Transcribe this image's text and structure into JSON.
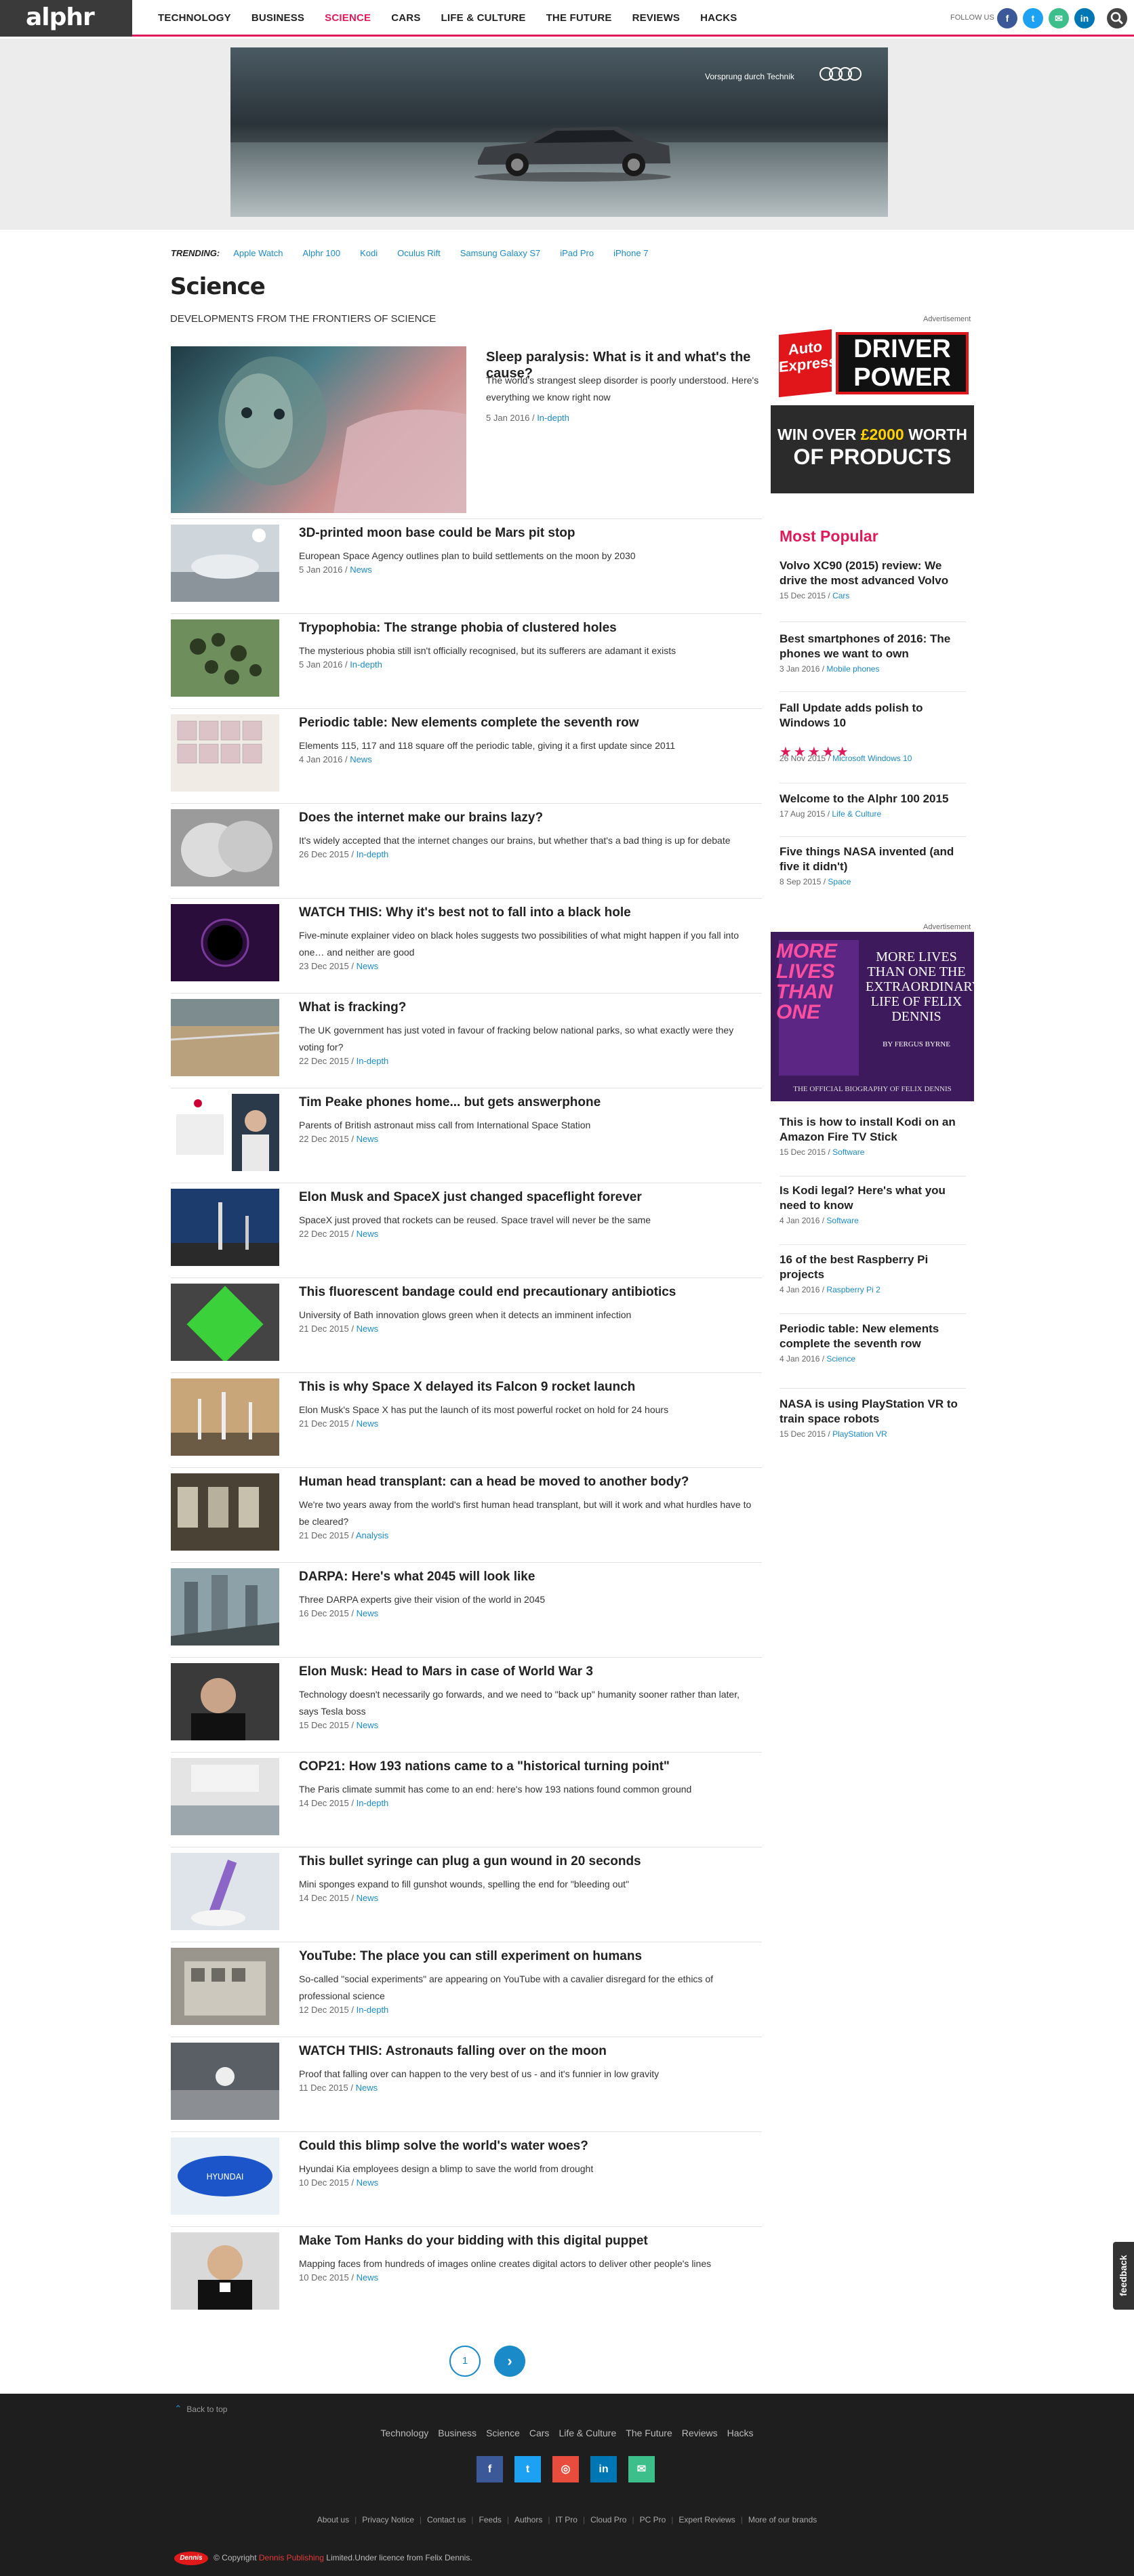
{
  "header": {
    "logo": "alphr",
    "nav": [
      "TECHNOLOGY",
      "BUSINESS",
      "SCIENCE",
      "CARS",
      "LIFE & CULTURE",
      "THE FUTURE",
      "REVIEWS",
      "HACKS"
    ],
    "active_nav": "SCIENCE",
    "follow_label": "FOLLOW US",
    "social": [
      {
        "icon": "facebook-icon",
        "glyph": "f",
        "color": "#3b5998"
      },
      {
        "icon": "twitter-icon",
        "glyph": "t",
        "color": "#1da1f2"
      },
      {
        "icon": "email-icon",
        "glyph": "✉",
        "color": "#3dbf8b"
      },
      {
        "icon": "linkedin-icon",
        "glyph": "in",
        "color": "#0077b5"
      }
    ]
  },
  "top_ad": {
    "brand_text": "Vorsprung durch Technik",
    "brand": "Audi"
  },
  "trending": {
    "label": "TRENDING:",
    "items": [
      "Apple Watch",
      "Alphr 100",
      "Kodi",
      "Oculus Rift",
      "Samsung Galaxy S7",
      "iPad Pro",
      "iPhone 7"
    ]
  },
  "page": {
    "title": "Science",
    "subtitle": "DEVELOPMENTS FROM THE FRONTIERS OF SCIENCE"
  },
  "featured": {
    "title": "Sleep paralysis: What is it and what's the cause?",
    "desc": "The world's strangest sleep disorder is poorly understood. Here's everything we know right now",
    "date": "5 Jan 2016",
    "tag": "In-depth"
  },
  "articles": [
    {
      "title": "3D-printed moon base could be Mars pit stop",
      "desc": "European Space Agency outlines plan to build settlements on the moon by 2030",
      "date": "5 Jan 2016",
      "tag": "News"
    },
    {
      "title": "Trypophobia: The strange phobia of clustered holes",
      "desc": "The mysterious phobia still isn't officially recognised, but its sufferers are adamant it exists",
      "date": "5 Jan 2016",
      "tag": "In-depth"
    },
    {
      "title": "Periodic table: New elements complete the seventh row",
      "desc": "Elements 115, 117 and 118 square off the periodic table, giving it a first update since 2011",
      "date": "4 Jan 2016",
      "tag": "News"
    },
    {
      "title": "Does the internet make our brains lazy?",
      "desc": "It's widely accepted that the internet changes our brains, but whether that's a bad thing is up for debate",
      "date": "26 Dec 2015",
      "tag": "In-depth"
    },
    {
      "title": "WATCH THIS: Why it's best not to fall into a black hole",
      "desc": "Five-minute explainer video on black holes suggests two possibilities of what might happen if you fall into one… and neither are good",
      "date": "23 Dec 2015",
      "tag": "News"
    },
    {
      "title": "What is fracking?",
      "desc": "The UK government has just voted in favour of fracking below national parks, so what exactly were they voting for?",
      "date": "22 Dec 2015",
      "tag": "In-depth"
    },
    {
      "title": "Tim Peake phones home... but gets answerphone",
      "desc": "Parents of British astronaut miss call from International Space Station",
      "date": "22 Dec 2015",
      "tag": "News"
    },
    {
      "title": "Elon Musk and SpaceX just changed spaceflight forever",
      "desc": "SpaceX just proved that rockets can be reused. Space travel will never be the same",
      "date": "22 Dec 2015",
      "tag": "News"
    },
    {
      "title": "This fluorescent bandage could end precautionary antibiotics",
      "desc": "University of Bath innovation glows green when it detects an imminent infection",
      "date": "21 Dec 2015",
      "tag": "News"
    },
    {
      "title": "This is why Space X delayed its Falcon 9 rocket launch",
      "desc": "Elon Musk's Space X has put the launch of its most powerful rocket on hold for 24 hours",
      "date": "21 Dec 2015",
      "tag": "News"
    },
    {
      "title": "Human head transplant: can a head be moved to another body?",
      "desc": "We're two years away from the world's first human head transplant, but will it work and what hurdles have to be cleared?",
      "date": "21 Dec 2015",
      "tag": "Analysis"
    },
    {
      "title": "DARPA: Here's what 2045 will look like",
      "desc": "Three DARPA experts give their vision of the world in 2045",
      "date": "16 Dec 2015",
      "tag": "News"
    },
    {
      "title": "Elon Musk: Head to Mars in case of World War 3",
      "desc": "Technology doesn't necessarily go forwards, and we need to \"back up\" humanity sooner rather than later, says Tesla boss",
      "date": "15 Dec 2015",
      "tag": "News"
    },
    {
      "title": "COP21: How 193 nations came to a \"historical turning point\"",
      "desc": "The Paris climate summit has come to an end: here's how 193 nations found common ground",
      "date": "14 Dec 2015",
      "tag": "In-depth"
    },
    {
      "title": "This bullet syringe can plug a gun wound in 20 seconds",
      "desc": "Mini sponges expand to fill gunshot wounds, spelling the end for \"bleeding out\"",
      "date": "14 Dec 2015",
      "tag": "News"
    },
    {
      "title": "YouTube: The place you can still experiment on humans",
      "desc": "So-called \"social experiments\" are appearing on YouTube with a cavalier disregard for the ethics of professional science",
      "date": "12 Dec 2015",
      "tag": "In-depth"
    },
    {
      "title": "WATCH THIS: Astronauts falling over on the moon",
      "desc": "Proof that falling over can happen to the very best of us - and it's funnier in low gravity",
      "date": "11 Dec 2015",
      "tag": "News"
    },
    {
      "title": "Could this blimp solve the world's water woes?",
      "desc": "Hyundai Kia employees design a blimp to save the world from drought",
      "date": "10 Dec 2015",
      "tag": "News"
    },
    {
      "title": "Make Tom Hanks do your bidding with this digital puppet",
      "desc": "Mapping faces from hundreds of images online creates digital actors to deliver other people's lines",
      "date": "10 Dec 2015",
      "tag": "News"
    }
  ],
  "sidebar": {
    "ad_label": "Advertisement",
    "ad1": {
      "left": "Auto Express",
      "right": "DRIVER POWER",
      "line1a": "WIN OVER ",
      "line1b": "£2000",
      "line1c": " WORTH",
      "line2": "OF PRODUCTS"
    },
    "popular_title": "Most Popular",
    "popular": [
      {
        "title": "Volvo XC90 (2015) review: We drive the most advanced Volvo",
        "date": "15 Dec 2015",
        "tag": "Cars"
      },
      {
        "title": "Best smartphones of 2016: The phones we want to own",
        "date": "3 Jan 2016",
        "tag": "Mobile phones"
      },
      {
        "title": "Fall Update adds polish to Windows 10",
        "date": "26 Nov 2015",
        "tag": "Microsoft Windows 10",
        "rating": 5
      },
      {
        "title": "Welcome to the Alphr 100 2015",
        "date": "17 Aug 2015",
        "tag": "Life & Culture"
      },
      {
        "title": "Five things NASA invented (and five it didn't)",
        "date": "8 Sep 2015",
        "tag": "Space"
      }
    ],
    "ad2": {
      "more": "MORE LIVES THAN ONE",
      "title": "MORE LIVES THAN ONE THE EXTRAORDINARY LIFE OF FELIX DENNIS",
      "by": "BY FERGUS BYRNE",
      "footer": "THE OFFICIAL BIOGRAPHY OF FELIX DENNIS"
    },
    "more": [
      {
        "title": "This is how to install Kodi on an Amazon Fire TV Stick",
        "date": "15 Dec 2015",
        "tag": "Software"
      },
      {
        "title": "Is Kodi legal? Here's what you need to know",
        "date": "4 Jan 2016",
        "tag": "Software"
      },
      {
        "title": "16 of the best Raspberry Pi projects",
        "date": "4 Jan 2016",
        "tag": "Raspberry Pi 2"
      },
      {
        "title": "Periodic table: New elements complete the seventh row",
        "date": "4 Jan 2016",
        "tag": "Science"
      },
      {
        "title": "NASA is using PlayStation VR to train space robots",
        "date": "15 Dec 2015",
        "tag": "PlayStation VR"
      }
    ]
  },
  "pagination": {
    "current": "1",
    "next": "›"
  },
  "footer": {
    "back_to_top": "Back to top",
    "nav": [
      "Technology",
      "Business",
      "Science",
      "Cars",
      "Life & Culture",
      "The Future",
      "Reviews",
      "Hacks"
    ],
    "social": [
      {
        "icon": "facebook-icon",
        "glyph": "f",
        "color": "#3b5998"
      },
      {
        "icon": "twitter-icon",
        "glyph": "t",
        "color": "#1da1f2"
      },
      {
        "icon": "instagram-icon",
        "glyph": "◎",
        "color": "#e74c3c"
      },
      {
        "icon": "linkedin-icon",
        "glyph": "in",
        "color": "#0077b5"
      },
      {
        "icon": "email-icon",
        "glyph": "✉",
        "color": "#3dbf8b"
      }
    ],
    "links": [
      "About us",
      "Privacy Notice",
      "Contact us",
      "Feeds",
      "Authors",
      "IT Pro",
      "Cloud Pro",
      "PC Pro",
      "Expert Reviews",
      "More of our brands"
    ],
    "copyright_prefix": "© Copyright ",
    "copyright_link": "Dennis Publishing",
    "copyright_suffix": " Limited.Under licence from Felix Dennis.",
    "dennis_logo": "Dennis"
  },
  "feedback": "feedback"
}
